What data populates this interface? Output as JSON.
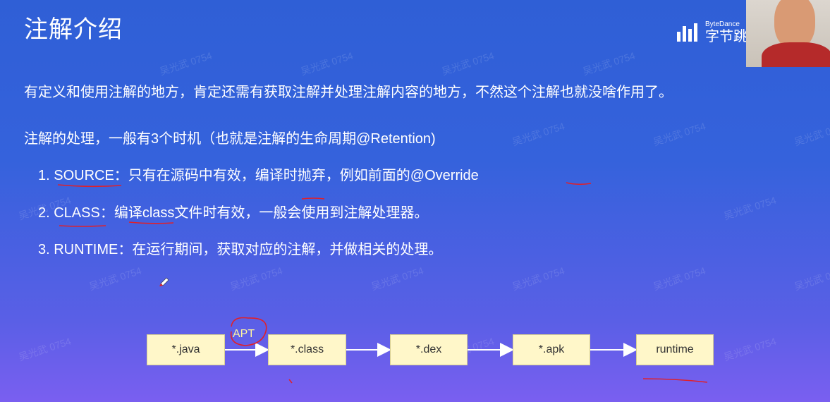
{
  "slide": {
    "title": "注解介绍",
    "intro": "有定义和使用注解的地方，肯定还需有获取注解并处理注解内容的地方，不然这个注解也就没啥作用了。",
    "subhead": "注解的处理，一般有3个时机（也就是注解的生命周期@Retention)",
    "items": [
      {
        "label": "1. SOURCE：只有在源码中有效，编译时抛弃，例如前面的@Override"
      },
      {
        "label": "2. CLASS：编译class文件时有效，一般会使用到注解处理器。"
      },
      {
        "label": "3. RUNTIME：在运行期间，获取对应的注解，并做相关的处理。"
      }
    ]
  },
  "logo": {
    "en": "ByteDance",
    "cn": "字节跳"
  },
  "watermark_text": "吴光武 0754",
  "flow": {
    "nodes": [
      "*.java",
      "*.class",
      "*.dex",
      "*.apk",
      "runtime"
    ],
    "annotation": "APT"
  },
  "colors": {
    "ink_red": "#e0202a",
    "node_bg": "#fff7c9",
    "arrow": "#ffffff"
  }
}
